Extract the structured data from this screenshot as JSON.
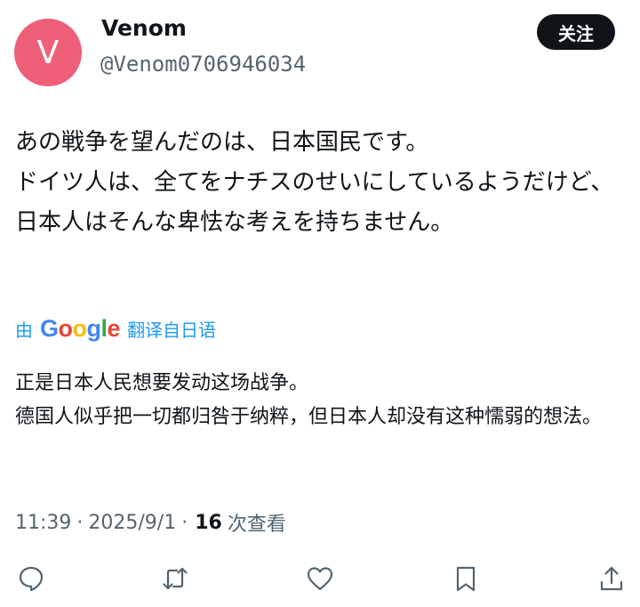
{
  "author": {
    "avatar_letter": "V",
    "avatar_color": "#ee5f79",
    "name": "Venom",
    "handle": "@Venom0706946034"
  },
  "follow_label": "关注",
  "original_text": "あの戦争を望んだのは、日本国民です。\nドイツ人は、全てをナチスのせいにしているようだけど、日本人はそんな卑怯な考えを持ちません。",
  "translation": {
    "prefix": "由",
    "brand": "Google",
    "suffix": "翻译自日语",
    "text": "正是日本人民想要发动这场战争。\n德国人似乎把一切都归咎于纳粹，但日本人却没有这种懦弱的想法。"
  },
  "meta": {
    "time": "11:39",
    "date": "2025/9/1",
    "views_count": "16",
    "views_label": "次查看"
  },
  "actions": [
    {
      "icon": "reply-icon"
    },
    {
      "icon": "retweet-icon"
    },
    {
      "icon": "like-icon"
    },
    {
      "icon": "bookmark-icon"
    },
    {
      "icon": "share-icon"
    }
  ]
}
